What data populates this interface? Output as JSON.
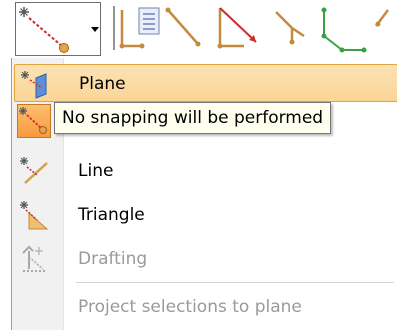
{
  "toolbar": {
    "split_button": {
      "icon": "snap-none-icon",
      "has_dropdown": true
    },
    "tools": [
      {
        "icon": "polyline-icon"
      },
      {
        "icon": "document-list-icon"
      },
      {
        "icon": "angle-line-icon"
      },
      {
        "icon": "red-triangle-icon"
      },
      {
        "icon": "wye-connector-icon"
      },
      {
        "icon": "green-polyline-icon"
      },
      {
        "icon": "partial-line-icon"
      }
    ]
  },
  "menu": {
    "items": [
      {
        "label": "Plane",
        "icon": "plane-snap-icon",
        "state": "highlighted"
      },
      {
        "label": "",
        "icon": "snap-none-icon",
        "state": "checked"
      },
      {
        "label": "Line",
        "icon": "line-snap-icon",
        "state": "normal"
      },
      {
        "label": "Triangle",
        "icon": "triangle-snap-icon",
        "state": "normal"
      },
      {
        "label": "Drafting",
        "icon": "drafting-snap-icon",
        "state": "disabled"
      },
      {
        "label": "Project selections to plane",
        "icon": "",
        "state": "disabled"
      }
    ]
  },
  "tooltip": {
    "text": "No snapping will be performed"
  },
  "colors": {
    "highlight_top": "#fbe2b4",
    "highlight_bottom": "#fbd596",
    "highlight_border": "#e3a33c",
    "checked_fill": "#f79a3e",
    "disabled_text": "#9a9a9a",
    "tooltip_bg": "#fffff0"
  }
}
